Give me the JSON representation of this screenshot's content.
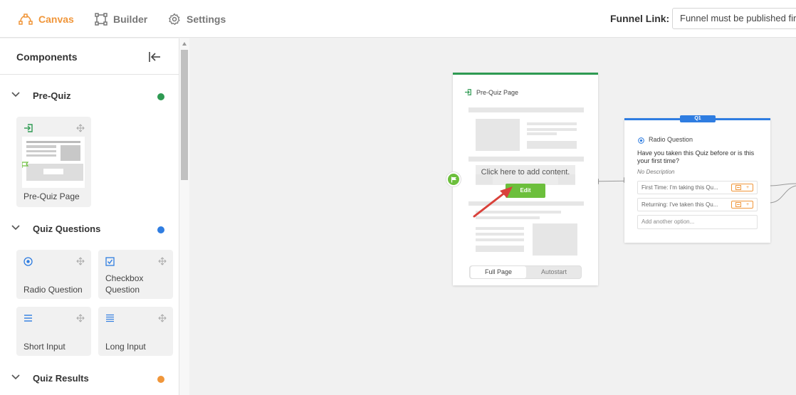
{
  "topbar": {
    "tabs": [
      {
        "label": "Canvas",
        "icon": "canvas-nodes-icon",
        "active": true
      },
      {
        "label": "Builder",
        "icon": "builder-frame-icon",
        "active": false
      },
      {
        "label": "Settings",
        "icon": "gear-icon",
        "active": false
      }
    ],
    "funnel_link_label": "Funnel Link:",
    "funnel_link_value": "Funnel must be published first"
  },
  "sidebar": {
    "title": "Components",
    "sections": [
      {
        "label": "Pre-Quiz",
        "dot_color": "#2e9a52",
        "cards": [
          {
            "label": "Pre-Quiz Page",
            "icon": "enter-page-icon"
          }
        ]
      },
      {
        "label": "Quiz Questions",
        "dot_color": "#2f7de1",
        "cards": [
          {
            "label": "Radio Question",
            "icon": "radio-icon"
          },
          {
            "label": "Checkbox Question",
            "icon": "checkbox-icon"
          },
          {
            "label": "Short Input",
            "icon": "short-lines-icon"
          },
          {
            "label": "Long Input",
            "icon": "long-lines-icon"
          }
        ]
      },
      {
        "label": "Quiz Results",
        "dot_color": "#f0963a",
        "cards": []
      }
    ]
  },
  "canvas": {
    "prequiz_node": {
      "title": "Pre-Quiz Page",
      "add_content_text": "Click here to add content.",
      "edit_label": "Edit",
      "toggle_options": [
        "Full Page",
        "Autostart"
      ],
      "accent": "#2e9a52"
    },
    "question_node": {
      "badge": "Q1",
      "type_label": "Radio Question",
      "question_text": "Have you taken this Quiz before or is this your first time?",
      "description": "No Description",
      "options": [
        "First Time: I'm taking this Qu...",
        "Returning: I've taken this Qu..."
      ],
      "add_option_placeholder": "Add another option...",
      "accent": "#2f7de1"
    }
  },
  "colors": {
    "canvas_accent": "#f0963a",
    "edit_button": "#6cbf3c",
    "annotation_arrow": "#d9413a"
  }
}
